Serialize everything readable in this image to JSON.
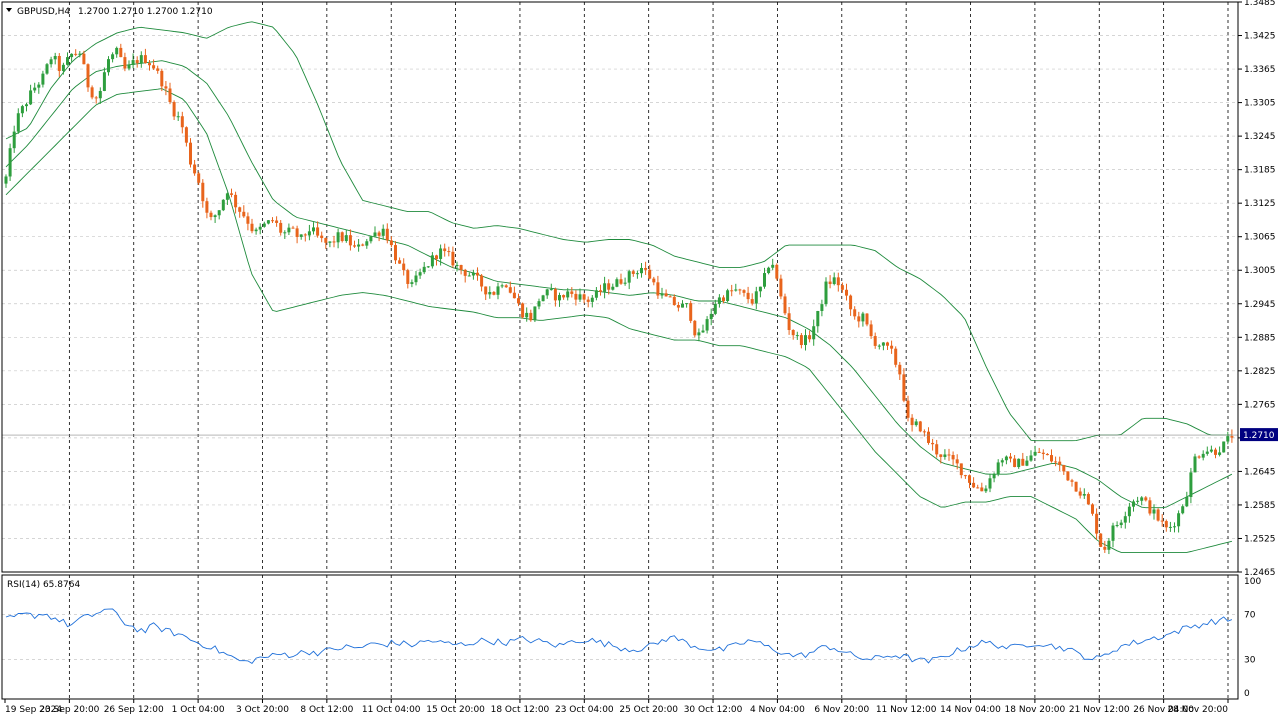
{
  "window": {
    "symbol_label": "GBPUSD,H4",
    "ohlc_text": "1.2700 1.2710 1.2700 1.2710",
    "current_price_label": "1.2710",
    "rsi_label": "RSI(14) 65.8764"
  },
  "colors": {
    "background": "#ffffff",
    "bull": "#2e9e3e",
    "bear": "#e8641c",
    "bands": "#1e8a3c",
    "rsi_line": "#1e6fd9",
    "price_tag_bg": "#000080",
    "grid": "#c8c8c8"
  },
  "chart_data": [
    {
      "type": "candlestick",
      "symbol": "GBPUSD",
      "timeframe": "H4",
      "indicator": "Bollinger Bands",
      "ylim": [
        1.2465,
        1.3485
      ],
      "y_ticks": [
        "1.3485",
        "1.3425",
        "1.3365",
        "1.3305",
        "1.3245",
        "1.3185",
        "1.3125",
        "1.3065",
        "1.3005",
        "1.2945",
        "1.2885",
        "1.2825",
        "1.2765",
        "1.2705",
        "1.2645",
        "1.2585",
        "1.2525",
        "1.2465"
      ],
      "x_ticks": [
        "19 Sep 2024",
        "23 Sep 20:00",
        "26 Sep 12:00",
        "1 Oct 04:00",
        "3 Oct 20:00",
        "8 Oct 12:00",
        "11 Oct 04:00",
        "15 Oct 20:00",
        "18 Oct 12:00",
        "23 Oct 04:00",
        "25 Oct 20:00",
        "30 Oct 12:00",
        "4 Nov 04:00",
        "6 Nov 20:00",
        "11 Nov 12:00",
        "14 Nov 04:00",
        "18 Nov 20:00",
        "21 Nov 12:00",
        "26 Nov 04:00",
        "28 Nov 20:00"
      ],
      "last_price": 1.271,
      "grid": true,
      "close_anchors": [
        1.317,
        1.327,
        1.33,
        1.333,
        1.335,
        1.339,
        1.336,
        1.339,
        1.3395,
        1.333,
        1.331,
        1.338,
        1.3395,
        1.336,
        1.338,
        1.3385,
        1.337,
        1.334,
        1.3295,
        1.327,
        1.32,
        1.316,
        1.309,
        1.311,
        1.315,
        1.312,
        1.31,
        1.307,
        1.3085,
        1.3095,
        1.307,
        1.3075,
        1.306,
        1.308,
        1.306,
        1.305,
        1.3065,
        1.306,
        1.304,
        1.306,
        1.307,
        1.308,
        1.304,
        1.3,
        1.2975,
        1.3,
        1.302,
        1.304,
        1.303,
        1.301,
        1.3,
        1.299,
        1.297,
        1.2965,
        1.299,
        1.296,
        1.293,
        1.292,
        1.296,
        1.2965,
        1.2955,
        1.2965,
        1.296,
        1.295,
        1.296,
        1.2975,
        1.298,
        1.299,
        1.3,
        1.301,
        1.299,
        1.296,
        1.295,
        1.294,
        1.294,
        1.288,
        1.291,
        1.295,
        1.296,
        1.297,
        1.296,
        1.295,
        1.2975,
        1.303,
        1.296,
        1.29,
        1.288,
        1.288,
        1.292,
        1.298,
        1.299,
        1.296,
        1.292,
        1.292,
        1.288,
        1.287,
        1.286,
        1.282,
        1.272,
        1.273,
        1.27,
        1.268,
        1.267,
        1.266,
        1.264,
        1.262,
        1.261,
        1.264,
        1.267,
        1.266,
        1.266,
        1.267,
        1.268,
        1.267,
        1.266,
        1.264,
        1.262,
        1.26,
        1.256,
        1.25,
        1.254,
        1.256,
        1.259,
        1.26,
        1.258,
        1.256,
        1.254,
        1.256,
        1.26,
        1.267,
        1.2685,
        1.268,
        1.269,
        1.271
      ],
      "bollinger": {
        "period_note": "",
        "upper_anchors": [
          1.324,
          1.326,
          1.333,
          1.338,
          1.341,
          1.343,
          1.344,
          1.3435,
          1.343,
          1.342,
          1.344,
          1.345,
          1.344,
          1.339,
          1.33,
          1.32,
          1.313,
          1.312,
          1.311,
          1.311,
          1.309,
          1.308,
          1.3085,
          1.308,
          1.307,
          1.306,
          1.3055,
          1.306,
          1.306,
          1.305,
          1.303,
          1.302,
          1.301,
          1.301,
          1.302,
          1.305,
          1.305,
          1.305,
          1.305,
          1.304,
          1.301,
          1.299,
          1.296,
          1.292,
          1.283,
          1.275,
          1.27,
          1.27,
          1.27,
          1.271,
          1.271,
          1.274,
          1.274,
          1.273,
          1.271,
          1.271
        ],
        "middle_anchors": [
          1.319,
          1.323,
          1.328,
          1.333,
          1.336,
          1.337,
          1.3375,
          1.338,
          1.337,
          1.334,
          1.328,
          1.32,
          1.313,
          1.31,
          1.309,
          1.308,
          1.307,
          1.306,
          1.305,
          1.303,
          1.301,
          1.3,
          1.2985,
          1.298,
          1.2975,
          1.297,
          1.297,
          1.2965,
          1.296,
          1.2965,
          1.296,
          1.295,
          1.295,
          1.294,
          1.293,
          1.292,
          1.29,
          1.287,
          1.283,
          1.278,
          1.273,
          1.269,
          1.266,
          1.265,
          1.264,
          1.264,
          1.265,
          1.266,
          1.265,
          1.263,
          1.26,
          1.258,
          1.258,
          1.26,
          1.262,
          1.264
        ],
        "lower_anchors": [
          1.314,
          1.318,
          1.322,
          1.326,
          1.33,
          1.332,
          1.3325,
          1.333,
          1.331,
          1.325,
          1.314,
          1.3,
          1.293,
          1.294,
          1.295,
          1.296,
          1.2965,
          1.296,
          1.295,
          1.294,
          1.2935,
          1.293,
          1.292,
          1.292,
          1.2915,
          1.292,
          1.2925,
          1.292,
          1.29,
          1.289,
          1.288,
          1.288,
          1.287,
          1.287,
          1.286,
          1.285,
          1.283,
          1.278,
          1.273,
          1.268,
          1.264,
          1.26,
          1.258,
          1.259,
          1.259,
          1.26,
          1.26,
          1.258,
          1.256,
          1.252,
          1.25,
          1.25,
          1.25,
          1.25,
          1.251,
          1.252
        ]
      }
    },
    {
      "type": "line",
      "indicator": "RSI(14)",
      "ylim": [
        0,
        100
      ],
      "y_ticks": [
        "100",
        "70",
        "30",
        "0"
      ],
      "last_value": 65.8764,
      "values": [
        65,
        68,
        70,
        69,
        71,
        68,
        64,
        60,
        66,
        68,
        72,
        75,
        70,
        62,
        58,
        55,
        60,
        57,
        54,
        52,
        48,
        44,
        42,
        38,
        34,
        30,
        27,
        30,
        32,
        33,
        35,
        34,
        36,
        37,
        36,
        38,
        40,
        41,
        40,
        42,
        44,
        43,
        45,
        44,
        43,
        45,
        47,
        45,
        44,
        43,
        44,
        46,
        47,
        46,
        45,
        46,
        48,
        47,
        46,
        44,
        42,
        45,
        47,
        48,
        46,
        44,
        42,
        40,
        39,
        40,
        42,
        46,
        50,
        48,
        44,
        41,
        40,
        38,
        39,
        42,
        45,
        47,
        43,
        40,
        37,
        34,
        33,
        35,
        38,
        42,
        40,
        36,
        33,
        31,
        30,
        32,
        34,
        33,
        31,
        29,
        28,
        30,
        34,
        37,
        40,
        43,
        45,
        44,
        42,
        40,
        42,
        44,
        45,
        43,
        41,
        40,
        36,
        33,
        30,
        32,
        38,
        42,
        44,
        46,
        48,
        50,
        52,
        55,
        58,
        60,
        62,
        64,
        65,
        66
      ]
    }
  ]
}
